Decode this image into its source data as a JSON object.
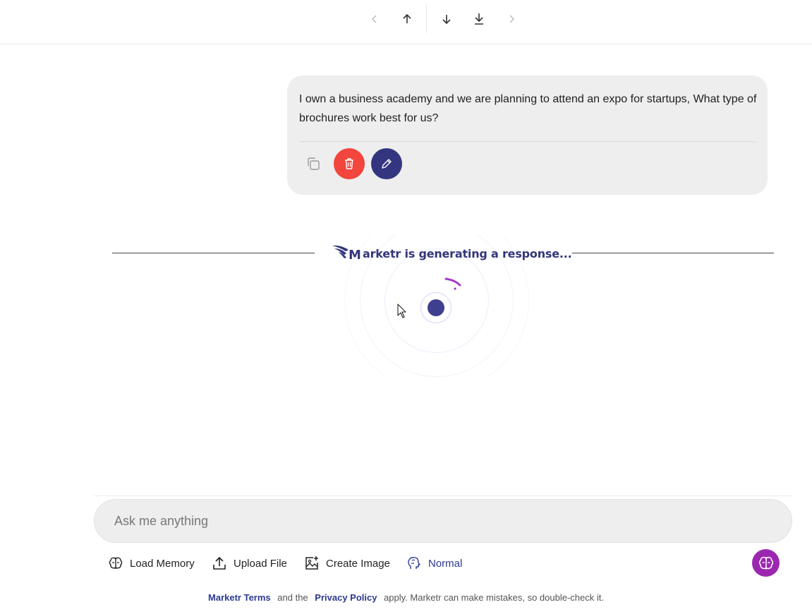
{
  "nav": {
    "icons": [
      "chevron-left-icon",
      "arrow-up-icon",
      "arrow-down-icon",
      "download-icon",
      "chevron-right-icon"
    ]
  },
  "message": {
    "text": "I own a business academy and we are planning to attend an expo for startups, What type of brochures work best for us?",
    "actions": [
      "copy-icon",
      "trash-icon",
      "pencil-icon"
    ]
  },
  "status": {
    "brand_letter": "M",
    "generating_text": "arketr is generating a response..."
  },
  "composer": {
    "placeholder": "Ask me anything"
  },
  "tools": {
    "load_memory": "Load Memory",
    "upload_file": "Upload File",
    "create_image": "Create Image",
    "mode": "Normal"
  },
  "footer": {
    "terms_link": "Marketr Terms",
    "middle": "and the",
    "privacy_link": "Privacy Policy",
    "tail": "apply. Marketr can make mistakes, so double-check it."
  },
  "colors": {
    "delete": "#f2453d",
    "edit": "#34357f",
    "brand": "#33367a",
    "fab": "#9b27b0"
  }
}
